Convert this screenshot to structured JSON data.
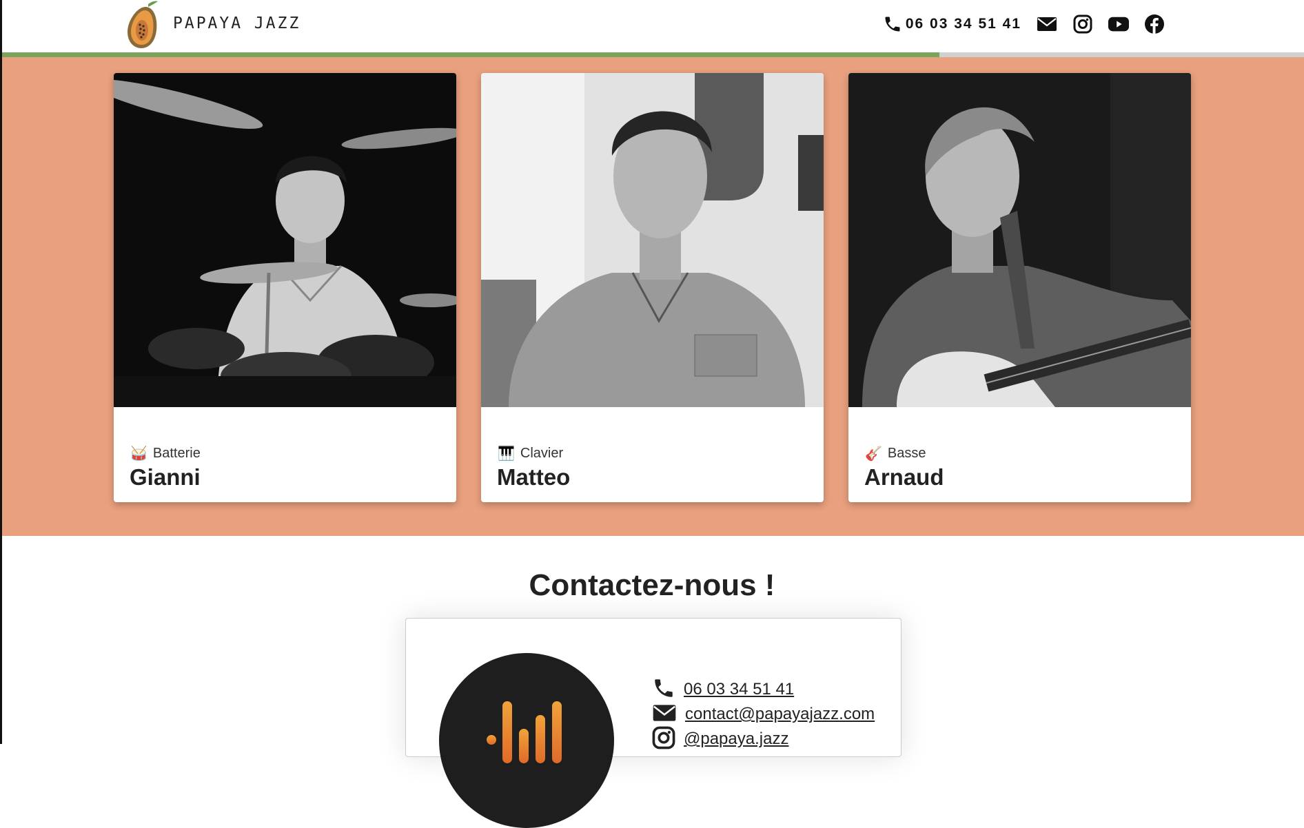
{
  "header": {
    "brand": "PAPAYA JAZZ",
    "phone": "06 03 34 51 41",
    "icons": [
      "phone-icon",
      "envelope-icon",
      "instagram-icon",
      "youtube-icon",
      "facebook-icon"
    ],
    "progress": 0.72,
    "progress_color": "#7aa35e"
  },
  "band_color": "#e8a07e",
  "musicians": [
    {
      "role": "Batterie",
      "name": "Gianni",
      "emoji": "🥁"
    },
    {
      "role": "Clavier",
      "name": "Matteo",
      "emoji": "🎹"
    },
    {
      "role": "Basse",
      "name": "Arnaud",
      "emoji": "🎸"
    }
  ],
  "contact": {
    "title": "Contactez-nous !",
    "phone": "06 03 34 51 41",
    "email": "contact@papayajazz.com",
    "instagram": "@papaya.jazz"
  }
}
